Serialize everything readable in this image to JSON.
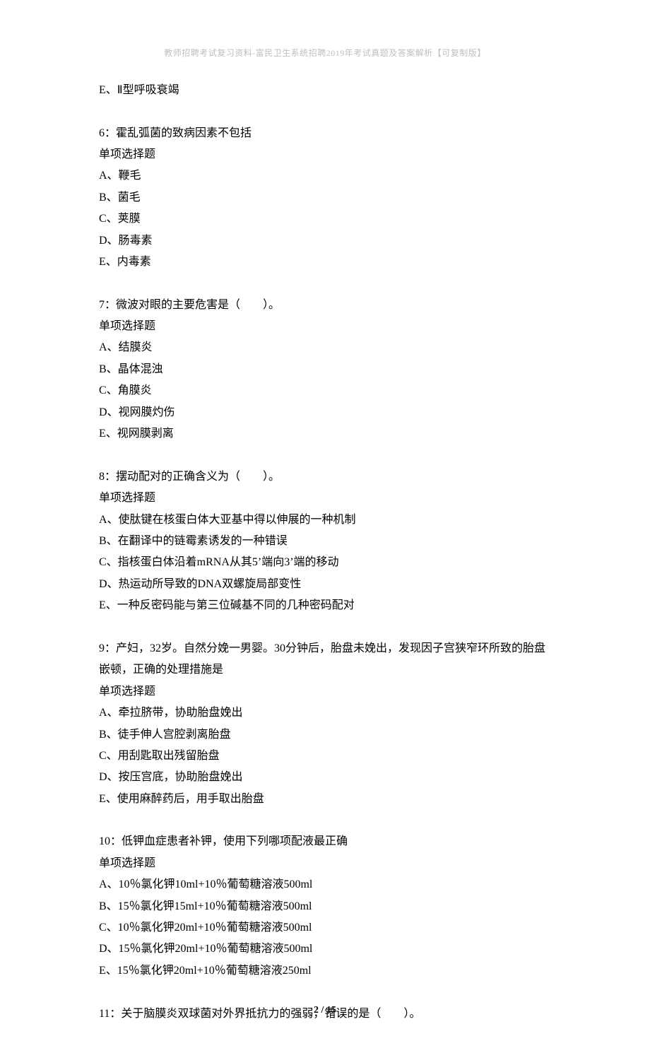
{
  "header": "教师招聘考试复习资料-富民卫生系统招聘2019年考试真题及答案解析【可复制版】",
  "q5_tail": {
    "optE": "E、Ⅱ型呼吸衰竭"
  },
  "q6": {
    "prompt": "6：霍乱弧菌的致病因素不包括",
    "type": "单项选择题",
    "optA": "A、鞭毛",
    "optB": "B、菌毛",
    "optC": "C、荚膜",
    "optD": "D、肠毒素",
    "optE": "E、内毒素"
  },
  "q7": {
    "prompt": "7：微波对眼的主要危害是（　　）。",
    "type": "单项选择题",
    "optA": "A、结膜炎",
    "optB": "B、晶体混浊",
    "optC": "C、角膜炎",
    "optD": "D、视网膜灼伤",
    "optE": "E、视网膜剥离"
  },
  "q8": {
    "prompt": "8：摆动配对的正确含义为（　　）。",
    "type": "单项选择题",
    "optA": "A、使肽键在核蛋白体大亚基中得以伸展的一种机制",
    "optB": "B、在翻译中的链霉素诱发的一种错误",
    "optC": "C、指核蛋白体沿着mRNA从其5’端向3’端的移动",
    "optD": "D、热运动所导致的DNA双螺旋局部变性",
    "optE": "E、一种反密码能与第三位碱基不同的几种密码配对"
  },
  "q9": {
    "prompt": "9：产妇，32岁。自然分娩一男婴。30分钟后，胎盘未娩出，发现因子宫狭窄环所致的胎盘嵌顿，正确的处理措施是",
    "type": "单项选择题",
    "optA": "A、牵拉脐带，协助胎盘娩出",
    "optB": "B、徒手伸人宫腔剥离胎盘",
    "optC": "C、用刮匙取出残留胎盘",
    "optD": "D、按压宫底，协助胎盘娩出",
    "optE": "E、使用麻醉药后，用手取出胎盘"
  },
  "q10": {
    "prompt": "10：低钾血症患者补钾，使用下列哪项配液最正确",
    "type": "单项选择题",
    "optA": "A、10％氯化钾10ml+10％葡萄糖溶液500ml",
    "optB": "B、15％氯化钾15ml+10％葡萄糖溶液500ml",
    "optC": "C、10％氯化钾20ml+10％葡萄糖溶液500ml",
    "optD": "D、15％氯化钾20ml+10％葡萄糖溶液500ml",
    "optE": "E、15％氯化钾20ml+10％葡萄糖溶液250ml"
  },
  "q11": {
    "prompt": "11：关于脑膜炎双球菌对外界抵抗力的强弱，错误的是（　　）。"
  },
  "footer": "2 / 15"
}
